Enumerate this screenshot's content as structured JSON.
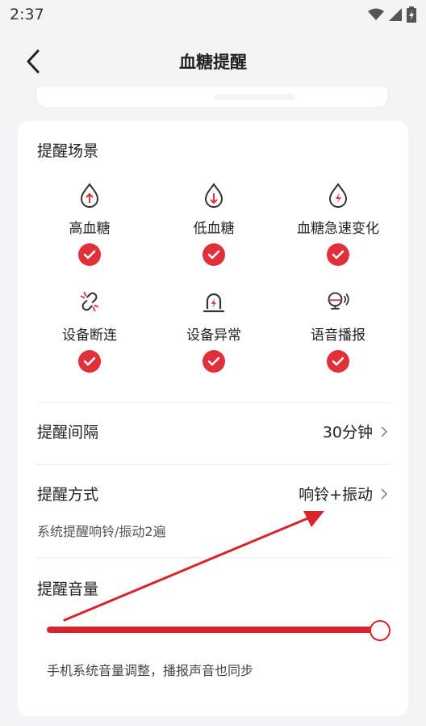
{
  "status_bar": {
    "time": "2:37"
  },
  "header": {
    "title": "血糖提醒"
  },
  "scenes": {
    "title": "提醒场景",
    "items": [
      {
        "label": "高血糖",
        "icon": "drop-up-arrow-icon",
        "checked": true
      },
      {
        "label": "低血糖",
        "icon": "drop-down-arrow-icon",
        "checked": true
      },
      {
        "label": "血糖急速变化",
        "icon": "drop-lightning-icon",
        "checked": true
      },
      {
        "label": "设备断连",
        "icon": "broken-link-icon",
        "checked": true
      },
      {
        "label": "设备异常",
        "icon": "alarm-light-icon",
        "checked": true
      },
      {
        "label": "语音播报",
        "icon": "speaker-voice-icon",
        "checked": true
      }
    ]
  },
  "interval": {
    "label": "提醒间隔",
    "value": "30分钟"
  },
  "method": {
    "label": "提醒方式",
    "value": "响铃+振动",
    "note": "系统提醒响铃/振动2遍"
  },
  "volume": {
    "label": "提醒音量",
    "level_percent": 100,
    "note": "手机系统音量调整，播报声音也同步"
  },
  "colors": {
    "accent": "#e0303a",
    "background": "#f4f4f6",
    "card": "#ffffff"
  }
}
